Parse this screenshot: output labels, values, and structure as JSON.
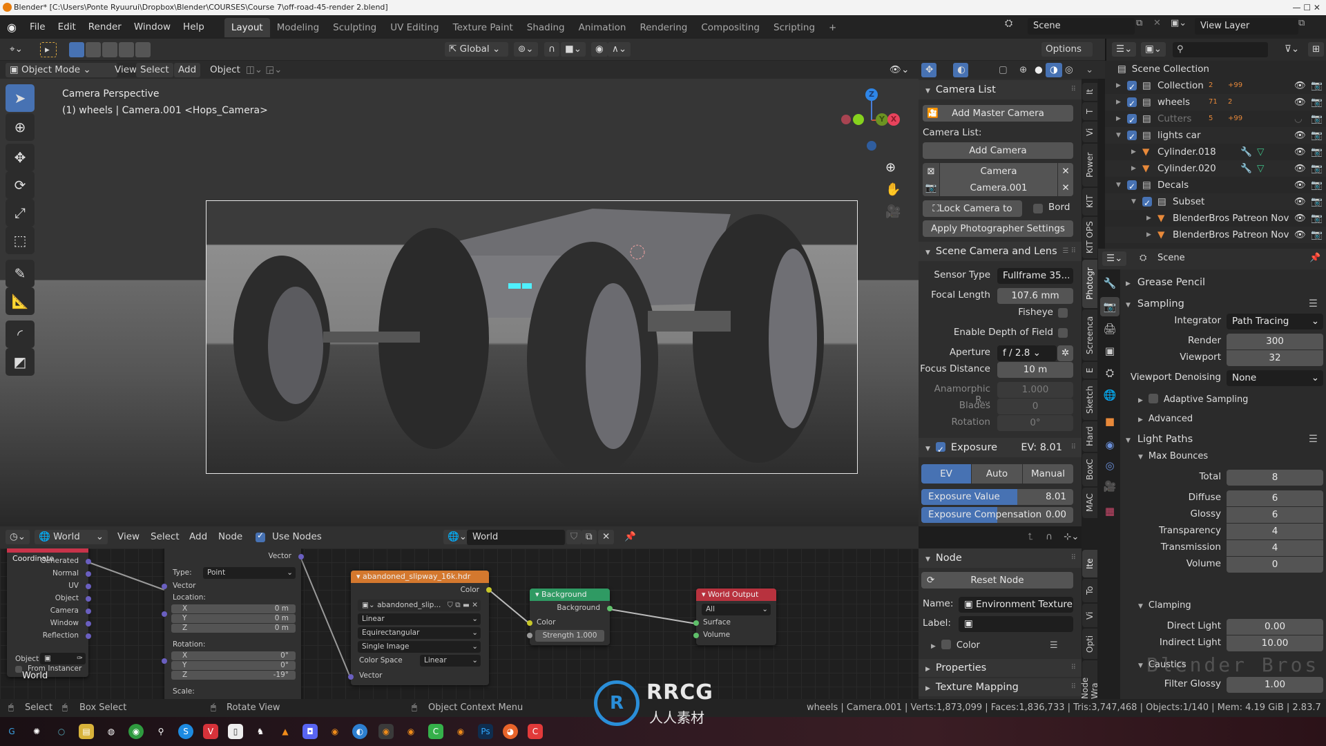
{
  "window": {
    "title": "Blender* [C:\\Users\\Ponte Ryuurui\\Dropbox\\Blender\\COURSES\\Course 7\\off-road-45-render 2.blend]"
  },
  "menubar": {
    "menus": [
      "File",
      "Edit",
      "Render",
      "Window",
      "Help"
    ],
    "workspaces": [
      "Layout",
      "Modeling",
      "Sculpting",
      "UV Editing",
      "Texture Paint",
      "Shading",
      "Animation",
      "Rendering",
      "Compositing",
      "Scripting"
    ],
    "active_workspace": "Layout",
    "add_workspace": "+",
    "scene_name": "Scene",
    "view_layer": "View Layer"
  },
  "tool_settings": {
    "orientation": "Global",
    "options_label": "Options"
  },
  "viewport_header": {
    "mode": "Object Mode",
    "menus": [
      "View",
      "Select",
      "Add",
      "Object"
    ]
  },
  "viewport": {
    "overlay_line1": "Camera Perspective",
    "overlay_line2": "(1) wheels | Camera.001 <Hops_Camera>",
    "gizmo": {
      "z": "Z",
      "y": "Y",
      "x": "X"
    }
  },
  "npanel": {
    "camera_list": {
      "title": "Camera List",
      "add_master": "Add Master Camera",
      "list_label": "Camera List:",
      "add_camera": "Add Camera",
      "cameras": [
        "Camera",
        "Camera.001"
      ],
      "lock_camera": "Lock Camera to Vi...",
      "border_label": "Bord",
      "apply_settings": "Apply Photographer Settings"
    },
    "scene_camera": {
      "title": "Scene Camera and Lens",
      "sensor_type_label": "Sensor Type",
      "sensor_type": "Fullframe 35...",
      "focal_length_label": "Focal Length",
      "focal_length": "107.6 mm",
      "fisheye_label": "Fisheye",
      "dof_label": "Enable Depth of Field",
      "aperture_label": "Aperture",
      "aperture": "f / 2.8",
      "focus_distance_label": "Focus Distance",
      "focus_distance": "10 m",
      "anamorphic_label": "Anamorphic R...",
      "anamorphic": "1.000",
      "blades_label": "Blades",
      "blades": "0",
      "rotation_label": "Rotation",
      "rotation": "0°"
    },
    "exposure": {
      "title": "Exposure",
      "ev_readout": "EV: 8.01",
      "modes": [
        "EV",
        "Auto",
        "Manual"
      ],
      "active_mode": "EV",
      "exposure_value_label": "Exposure Value",
      "exposure_value": "8.01",
      "exposure_value_fill": 0.63,
      "compensation_label": "Exposure Compensation",
      "compensation": "0.00",
      "compensation_fill": 0.5
    },
    "tabs": [
      "It",
      "T",
      "Vi",
      "Power",
      "KIT",
      "KIT OPS",
      "Photogr",
      "Screenca",
      "E",
      "Sketch",
      "Hard",
      "BoxC",
      "MAC"
    ],
    "active_tab": "Photogr"
  },
  "outliner": {
    "root": "Scene Collection",
    "rows": [
      {
        "name": "Collection",
        "depth": 1,
        "badges": [
          "2",
          "+99"
        ]
      },
      {
        "name": "wheels",
        "depth": 1,
        "badges": [
          "71",
          "2"
        ]
      },
      {
        "name": "Cutters",
        "depth": 1,
        "badges": [
          "5",
          "+99"
        ],
        "hidden": true
      },
      {
        "name": "lights car",
        "depth": 1,
        "expanded": true
      },
      {
        "name": "Cylinder.018",
        "depth": 2,
        "type": "mesh"
      },
      {
        "name": "Cylinder.020",
        "depth": 2,
        "type": "mesh"
      },
      {
        "name": "Decals",
        "depth": 1,
        "expanded": true
      },
      {
        "name": "Subset",
        "depth": 2,
        "expanded": true
      },
      {
        "name": "BlenderBros Patreon Nov",
        "depth": 3,
        "type": "mesh"
      },
      {
        "name": "BlenderBros Patreon Nov",
        "depth": 3,
        "type": "mesh"
      }
    ]
  },
  "properties": {
    "context": "Scene",
    "grease_pencil": "Grease Pencil",
    "sampling": {
      "title": "Sampling",
      "integrator_label": "Integrator",
      "integrator": "Path Tracing",
      "render_label": "Render",
      "render": "300",
      "viewport_label": "Viewport",
      "viewport": "32",
      "denoising_label": "Viewport Denoising",
      "denoising": "None",
      "adaptive": "Adaptive Sampling",
      "advanced": "Advanced"
    },
    "light_paths": {
      "title": "Light Paths",
      "max_bounces": "Max Bounces",
      "rows": [
        {
          "label": "Total",
          "value": "8"
        },
        {
          "label": "Diffuse",
          "value": "6"
        },
        {
          "label": "Glossy",
          "value": "6"
        },
        {
          "label": "Transparency",
          "value": "4"
        },
        {
          "label": "Transmission",
          "value": "4"
        },
        {
          "label": "Volume",
          "value": "0"
        }
      ],
      "clamping": "Clamping",
      "direct_label": "Direct Light",
      "direct": "0.00",
      "indirect_label": "Indirect Light",
      "indirect": "10.00",
      "caustics": "Caustics",
      "filter_glossy_label": "Filter Glossy",
      "filter_glossy": "1.00"
    },
    "watermark": "Blender Bros"
  },
  "node_editor": {
    "header": {
      "type": "World",
      "menus": [
        "View",
        "Select",
        "Add",
        "Node"
      ],
      "use_nodes": "Use Nodes",
      "world_name": "World"
    },
    "nodes": {
      "texcoord": {
        "title": "Texture Coordinate",
        "outputs": [
          "Generated",
          "Normal",
          "UV",
          "Object",
          "Camera",
          "Window",
          "Reflection"
        ],
        "object_label": "Object",
        "from_instancer": "From Instancer"
      },
      "mapping": {
        "output": "Vector",
        "type_label": "Type:",
        "type": "Point",
        "vector": "Vector",
        "location": "Location:",
        "loc": [
          [
            "X",
            "0 m"
          ],
          [
            "Y",
            "0 m"
          ],
          [
            "Z",
            "0 m"
          ]
        ],
        "rotation": "Rotation:",
        "rot": [
          [
            "X",
            "0°"
          ],
          [
            "Y",
            "0°"
          ],
          [
            "Z",
            "-19°"
          ]
        ],
        "scale": "Scale:"
      },
      "envtex": {
        "title": "abandoned_slipway_16k.hdr",
        "output": "Color",
        "image": "abandoned_slip...",
        "interp": "Linear",
        "projection": "Equirectangular",
        "source": "Single Image",
        "colorspace_label": "Color Space",
        "colorspace": "Linear",
        "input": "Vector"
      },
      "background": {
        "title": "Background",
        "output": "Background",
        "color": "Color",
        "strength_label": "Strength",
        "strength": "1.000"
      },
      "world_output": {
        "title": "World Output",
        "target": "All",
        "surface": "Surface",
        "volume": "Volume"
      }
    },
    "frame_label": "World"
  },
  "node_sidebar": {
    "node_title": "Node",
    "reset": "Reset Node",
    "name_label": "Name:",
    "name": "Environment Texture",
    "label_label": "Label:",
    "label": "",
    "color": "Color",
    "properties": "Properties",
    "texture_mapping": "Texture Mapping",
    "tabs": [
      "Ite",
      "To",
      "Vi",
      "Opti",
      "Node Wra"
    ]
  },
  "statusbar": {
    "hints": [
      "Select",
      "Box Select",
      "Rotate View",
      "Object Context Menu"
    ],
    "stats": "wheels | Camera.001 | Verts:1,873,099 | Faces:1,836,733 | Tris:3,747,468 | Objects:1/140 | Mem: 4.19 GiB | 2.83.7"
  },
  "watermark": {
    "brand": "RRCG",
    "sub": "人人素材"
  },
  "colors": {
    "accent": "#4772b3",
    "node_texcoord": "#c8334a",
    "node_envtex": "#d4782e",
    "node_bg": "#2f9a63",
    "node_output": "#b8323e",
    "node_vector": "#6a5fc0"
  }
}
